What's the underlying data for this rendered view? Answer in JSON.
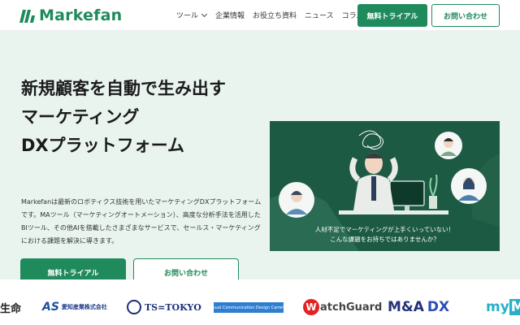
{
  "header": {
    "logo_text": "Markefan",
    "nav": [
      "ツール",
      "企業情報",
      "お役立ち資料",
      "ニュース",
      "コラム"
    ],
    "trial_button": "無料トライアル",
    "contact_button": "お問い合わせ"
  },
  "hero": {
    "headline": [
      "新規顧客を自動で生み出す",
      "マーケティング",
      "DXプラットフォーム"
    ],
    "description": "Markefanは最新のロボティクス技術を用いたマーケティングDXプラットフォームです。MAツール（マーケティングオートメーション）、高度な分析手法を活用したBIツール、その他AIを搭載したさまざまなサービスで、セールス・マーケティングにおける課題を解決に導きます。",
    "trial_button": "無料トライアル",
    "contact_button": "お問い合わせ",
    "illustration_caption": [
      "人材不足でマーケティングが上手くいっていない！",
      "こんな課題をお持ちではありませんか？"
    ]
  },
  "logos": {
    "l1": "生命",
    "l2_mark": "AS",
    "l2_name": "愛知産業株式会社",
    "l3": "TS=TOKYO",
    "l4": "Visual Communication Design Carrelva",
    "l5": "atchGuard",
    "l5_mark": "W",
    "l6": "M&A",
    "l6_dx": "DX",
    "l7": "my",
    "l7_me": "Me"
  },
  "colors": {
    "brand": "#1f8a5c",
    "hero_bg": "#e9f4ef",
    "illustration_bg": "#1d5a44"
  }
}
